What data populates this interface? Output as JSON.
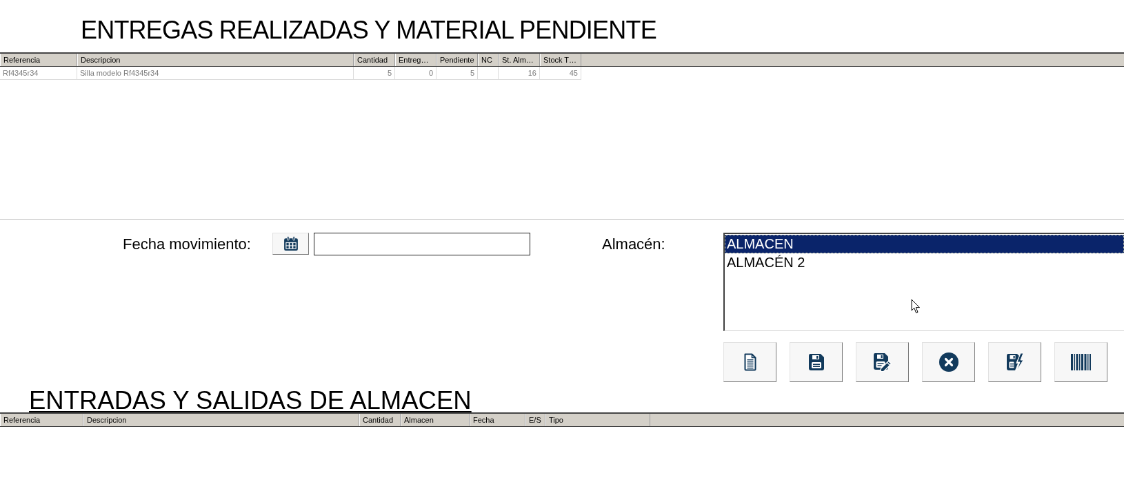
{
  "deliveries": {
    "title": "ENTREGAS REALIZADAS Y MATERIAL PENDIENTE",
    "columns": [
      "Referencia",
      "Descripcion",
      "Cantidad",
      "Entreg…",
      "Pendiente",
      "NC",
      "St. Alm…",
      "Stock T…"
    ],
    "rows": [
      {
        "cells": [
          "Rf4345r34",
          "Silla modelo Rf4345r34",
          "5",
          "0",
          "5",
          null,
          "16",
          "45"
        ]
      }
    ]
  },
  "movement_form": {
    "date_label": "Fecha movimiento:",
    "warehouse_label": "Almacén:",
    "warehouses": [
      {
        "label": "ALMACEN",
        "selected": true
      },
      {
        "label": "ALMACÉN 2",
        "selected": false
      }
    ]
  },
  "movements": {
    "title": "ENTRADAS Y SALIDAS DE ALMACEN",
    "columns": [
      "Referencia",
      "Descripcion",
      "Cantidad",
      "Almacen",
      "Fecha",
      "E/S",
      "Tipo"
    ]
  }
}
